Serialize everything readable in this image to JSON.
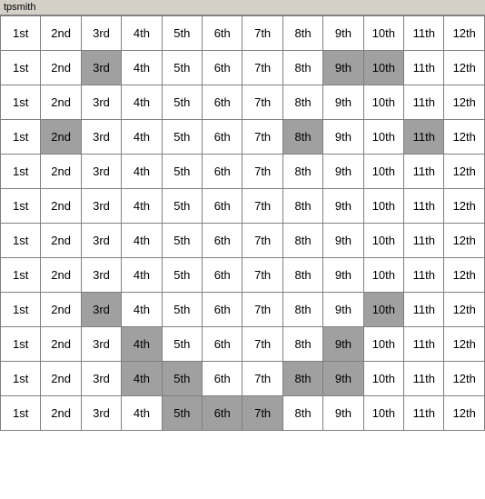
{
  "title": "tpsmith",
  "columns": [
    "1st",
    "2nd",
    "3rd",
    "4th",
    "5th",
    "6th",
    "7th",
    "8th",
    "9th",
    "10th",
    "11th",
    "12th"
  ],
  "rows": [
    {
      "cells": [
        {
          "text": "1st",
          "h": false
        },
        {
          "text": "2nd",
          "h": false
        },
        {
          "text": "3rd",
          "h": false
        },
        {
          "text": "4th",
          "h": false
        },
        {
          "text": "5th",
          "h": false
        },
        {
          "text": "6th",
          "h": false
        },
        {
          "text": "7th",
          "h": false
        },
        {
          "text": "8th",
          "h": false
        },
        {
          "text": "9th",
          "h": false
        },
        {
          "text": "10th",
          "h": false
        },
        {
          "text": "11th",
          "h": false
        },
        {
          "text": "12th",
          "h": false
        }
      ]
    },
    {
      "cells": [
        {
          "text": "1st",
          "h": false
        },
        {
          "text": "2nd",
          "h": false
        },
        {
          "text": "3rd",
          "h": true
        },
        {
          "text": "4th",
          "h": false
        },
        {
          "text": "5th",
          "h": false
        },
        {
          "text": "6th",
          "h": false
        },
        {
          "text": "7th",
          "h": false
        },
        {
          "text": "8th",
          "h": false
        },
        {
          "text": "9th",
          "h": true
        },
        {
          "text": "10th",
          "h": true
        },
        {
          "text": "11th",
          "h": false
        },
        {
          "text": "12th",
          "h": false
        }
      ]
    },
    {
      "cells": [
        {
          "text": "1st",
          "h": false
        },
        {
          "text": "2nd",
          "h": false
        },
        {
          "text": "3rd",
          "h": false
        },
        {
          "text": "4th",
          "h": false
        },
        {
          "text": "5th",
          "h": false
        },
        {
          "text": "6th",
          "h": false
        },
        {
          "text": "7th",
          "h": false
        },
        {
          "text": "8th",
          "h": false
        },
        {
          "text": "9th",
          "h": false
        },
        {
          "text": "10th",
          "h": false
        },
        {
          "text": "11th",
          "h": false
        },
        {
          "text": "12th",
          "h": false
        }
      ]
    },
    {
      "cells": [
        {
          "text": "1st",
          "h": false
        },
        {
          "text": "2nd",
          "h": true
        },
        {
          "text": "3rd",
          "h": false
        },
        {
          "text": "4th",
          "h": false
        },
        {
          "text": "5th",
          "h": false
        },
        {
          "text": "6th",
          "h": false
        },
        {
          "text": "7th",
          "h": false
        },
        {
          "text": "8th",
          "h": true
        },
        {
          "text": "9th",
          "h": false
        },
        {
          "text": "10th",
          "h": false
        },
        {
          "text": "11th",
          "h": true
        },
        {
          "text": "12th",
          "h": false
        }
      ]
    },
    {
      "cells": [
        {
          "text": "1st",
          "h": false
        },
        {
          "text": "2nd",
          "h": false
        },
        {
          "text": "3rd",
          "h": false
        },
        {
          "text": "4th",
          "h": false
        },
        {
          "text": "5th",
          "h": false
        },
        {
          "text": "6th",
          "h": false
        },
        {
          "text": "7th",
          "h": false
        },
        {
          "text": "8th",
          "h": false
        },
        {
          "text": "9th",
          "h": false
        },
        {
          "text": "10th",
          "h": false
        },
        {
          "text": "11th",
          "h": false
        },
        {
          "text": "12th",
          "h": false
        }
      ]
    },
    {
      "cells": [
        {
          "text": "1st",
          "h": false
        },
        {
          "text": "2nd",
          "h": false
        },
        {
          "text": "3rd",
          "h": false
        },
        {
          "text": "4th",
          "h": false
        },
        {
          "text": "5th",
          "h": false
        },
        {
          "text": "6th",
          "h": false
        },
        {
          "text": "7th",
          "h": false
        },
        {
          "text": "8th",
          "h": false
        },
        {
          "text": "9th",
          "h": false
        },
        {
          "text": "10th",
          "h": false
        },
        {
          "text": "11th",
          "h": false
        },
        {
          "text": "12th",
          "h": false
        }
      ]
    },
    {
      "cells": [
        {
          "text": "1st",
          "h": false
        },
        {
          "text": "2nd",
          "h": false
        },
        {
          "text": "3rd",
          "h": false
        },
        {
          "text": "4th",
          "h": false
        },
        {
          "text": "5th",
          "h": false
        },
        {
          "text": "6th",
          "h": false
        },
        {
          "text": "7th",
          "h": false
        },
        {
          "text": "8th",
          "h": false
        },
        {
          "text": "9th",
          "h": false
        },
        {
          "text": "10th",
          "h": false
        },
        {
          "text": "11th",
          "h": false
        },
        {
          "text": "12th",
          "h": false
        }
      ]
    },
    {
      "cells": [
        {
          "text": "1st",
          "h": false
        },
        {
          "text": "2nd",
          "h": false
        },
        {
          "text": "3rd",
          "h": false
        },
        {
          "text": "4th",
          "h": false
        },
        {
          "text": "5th",
          "h": false
        },
        {
          "text": "6th",
          "h": false
        },
        {
          "text": "7th",
          "h": false
        },
        {
          "text": "8th",
          "h": false
        },
        {
          "text": "9th",
          "h": false
        },
        {
          "text": "10th",
          "h": false
        },
        {
          "text": "11th",
          "h": false
        },
        {
          "text": "12th",
          "h": false
        }
      ]
    },
    {
      "cells": [
        {
          "text": "1st",
          "h": false
        },
        {
          "text": "2nd",
          "h": false
        },
        {
          "text": "3rd",
          "h": true
        },
        {
          "text": "4th",
          "h": false
        },
        {
          "text": "5th",
          "h": false
        },
        {
          "text": "6th",
          "h": false
        },
        {
          "text": "7th",
          "h": false
        },
        {
          "text": "8th",
          "h": false
        },
        {
          "text": "9th",
          "h": false
        },
        {
          "text": "10th",
          "h": true
        },
        {
          "text": "11th",
          "h": false
        },
        {
          "text": "12th",
          "h": false
        }
      ]
    },
    {
      "cells": [
        {
          "text": "1st",
          "h": false
        },
        {
          "text": "2nd",
          "h": false
        },
        {
          "text": "3rd",
          "h": false
        },
        {
          "text": "4th",
          "h": true
        },
        {
          "text": "5th",
          "h": false
        },
        {
          "text": "6th",
          "h": false
        },
        {
          "text": "7th",
          "h": false
        },
        {
          "text": "8th",
          "h": false
        },
        {
          "text": "9th",
          "h": true
        },
        {
          "text": "10th",
          "h": false
        },
        {
          "text": "11th",
          "h": false
        },
        {
          "text": "12th",
          "h": false
        }
      ]
    },
    {
      "cells": [
        {
          "text": "1st",
          "h": false
        },
        {
          "text": "2nd",
          "h": false
        },
        {
          "text": "3rd",
          "h": false
        },
        {
          "text": "4th",
          "h": true
        },
        {
          "text": "5th",
          "h": true
        },
        {
          "text": "6th",
          "h": false
        },
        {
          "text": "7th",
          "h": false
        },
        {
          "text": "8th",
          "h": true
        },
        {
          "text": "9th",
          "h": true
        },
        {
          "text": "10th",
          "h": false
        },
        {
          "text": "11th",
          "h": false
        },
        {
          "text": "12th",
          "h": false
        }
      ]
    },
    {
      "cells": [
        {
          "text": "1st",
          "h": false
        },
        {
          "text": "2nd",
          "h": false
        },
        {
          "text": "3rd",
          "h": false
        },
        {
          "text": "4th",
          "h": false
        },
        {
          "text": "5th",
          "h": true
        },
        {
          "text": "6th",
          "h": true
        },
        {
          "text": "7th",
          "h": true
        },
        {
          "text": "8th",
          "h": false
        },
        {
          "text": "9th",
          "h": false
        },
        {
          "text": "10th",
          "h": false
        },
        {
          "text": "11th",
          "h": false
        },
        {
          "text": "12th",
          "h": false
        }
      ]
    }
  ]
}
